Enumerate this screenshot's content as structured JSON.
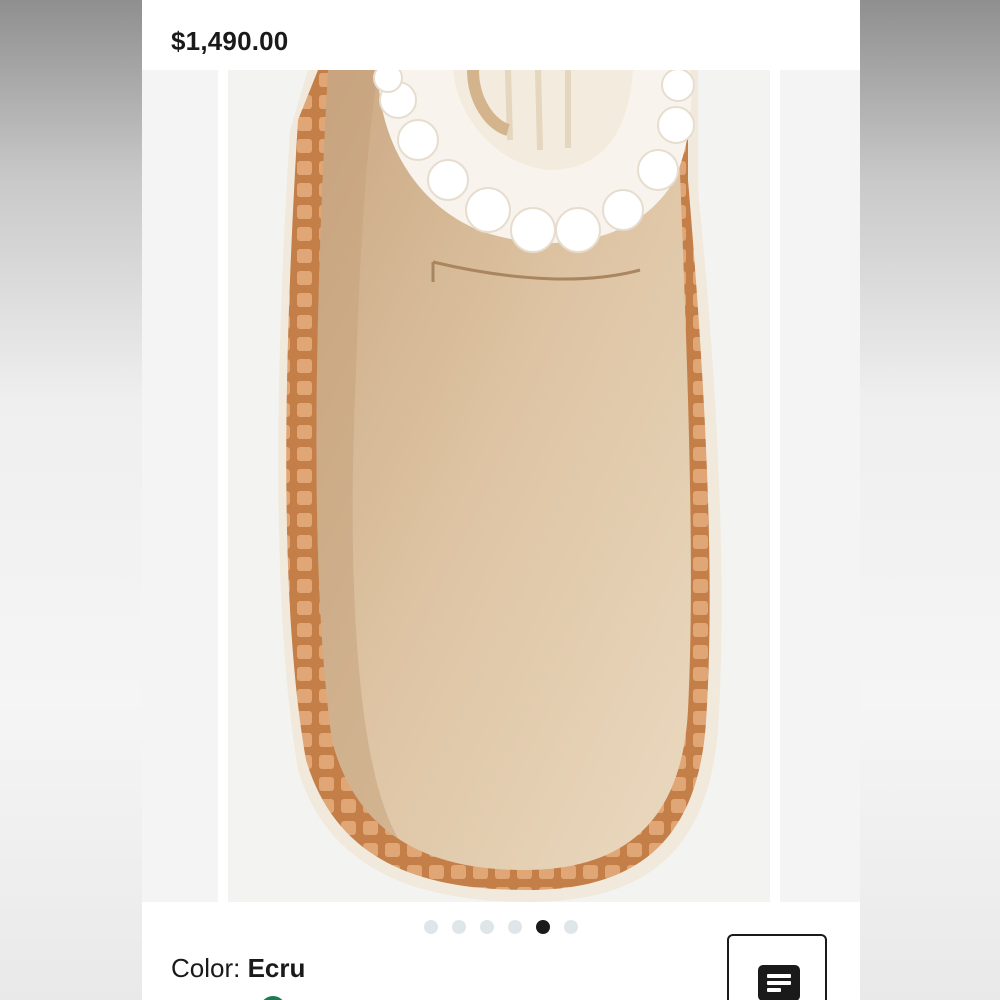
{
  "product": {
    "price": "$1,490.00",
    "image_alt": "Suede shearling-lined boot in ecru, top view"
  },
  "gallery": {
    "dot_count": 6,
    "active_index": 4
  },
  "color": {
    "label": "Color:",
    "value": "Ecru"
  },
  "icons": {
    "details": "document-lines-icon"
  },
  "colors": {
    "suede": "#dcc2a0",
    "sole": "#c9844c",
    "shearling": "#f7f3ec",
    "swatch": "#1f7a52"
  }
}
